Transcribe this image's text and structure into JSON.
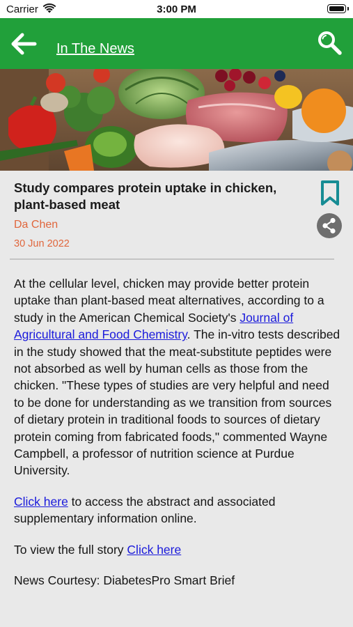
{
  "status_bar": {
    "carrier": "Carrier",
    "time": "3:00 PM"
  },
  "app_bar": {
    "title": "In The News",
    "back_icon": "arrow-left-icon",
    "search_icon": "search-icon",
    "background": "#21a03a"
  },
  "article": {
    "title": "Study compares protein uptake in chicken, plant-based meat",
    "author": "Da Chen",
    "date": "30 Jun 2022",
    "accent_color": "#e0663c",
    "bookmark_icon": "bookmark-icon",
    "share_icon": "share-icon",
    "body": {
      "p1_part1": "At the cellular level, chicken may provide better protein uptake than plant-based meat alternatives, according to a study in the American Chemical Society's ",
      "p1_link": "Journal of Agricultural and Food Chemistry",
      "p1_part2": ". The in-vitro tests described in the study showed that the meat-substitute peptides were not absorbed as well by human cells as those from the chicken. \"These types of studies are very helpful and need to be done for understanding as we transition from sources of dietary protein in traditional foods to sources of dietary protein coming from fabricated foods,\" commented Wayne Campbell, a professor of nutrition science at Purdue University.",
      "p2_link": "Click here",
      "p2_text": " to access the abstract and associated supplementary information online.",
      "p3_text": "To view the full story ",
      "p3_link": "Click here",
      "p4_text": "News Courtesy: DiabetesPro Smart Brief"
    }
  }
}
